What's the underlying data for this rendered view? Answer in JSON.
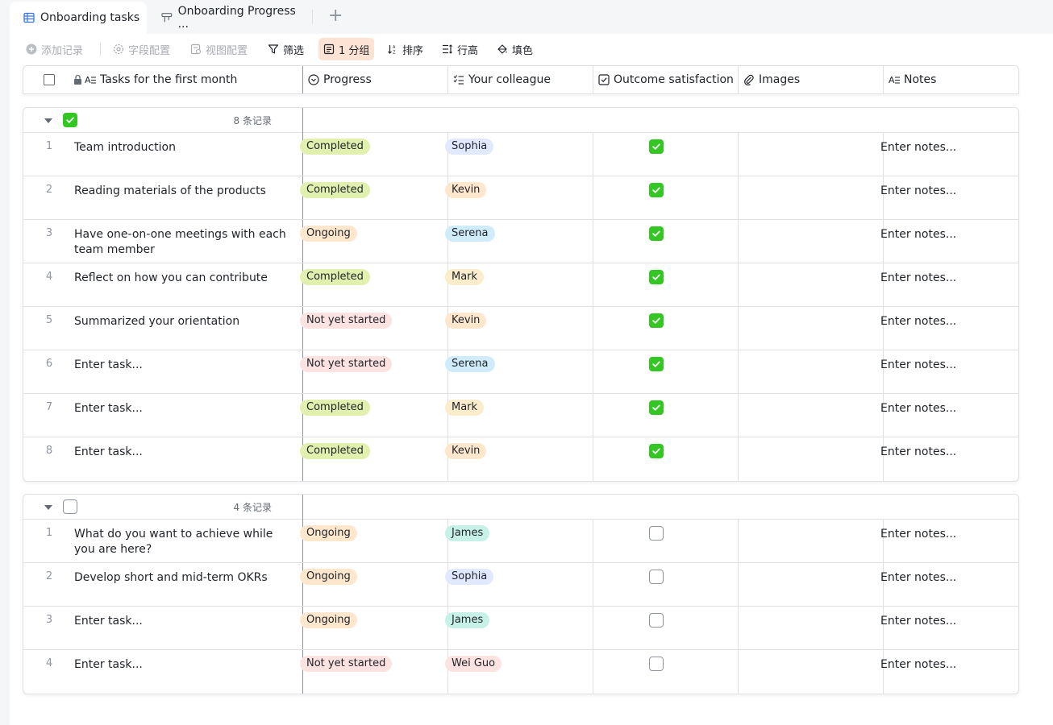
{
  "tabs": [
    {
      "label": "Onboarding tasks",
      "icon": "grid-table-icon",
      "active": true
    },
    {
      "label": "Onboarding Progress ...",
      "icon": "kanban-icon",
      "active": false
    }
  ],
  "toolbar": {
    "add_record": "添加记录",
    "field_config": "字段配置",
    "view_config": "视图配置",
    "filter": "筛选",
    "group": "1 分组",
    "sort": "排序",
    "row_height": "行高",
    "fill": "填色"
  },
  "columns": {
    "task": "Tasks for the first month",
    "progress": "Progress",
    "colleague": "Your colleague",
    "satisfaction": "Outcome satisfaction",
    "images": "Images",
    "notes": "Notes"
  },
  "colors": {
    "completed": "#e1f0ae",
    "ongoing": "#fee7cd",
    "not_started": "#fde2e2",
    "sophia": "#e0e9ff",
    "kevin": "#fee7cd",
    "serena": "#d0ecfb",
    "mark": "#fbeccb",
    "james": "#c7f1e7",
    "wei_guo": "#fde2e2",
    "check_green": "#34c724",
    "accent": "#3370ff"
  },
  "groups": [
    {
      "checked": true,
      "count_label": "8 条记录",
      "rows": [
        {
          "num": "1",
          "task": "Team introduction",
          "progress": "Completed",
          "colleague": "Sophia",
          "satisfied": true,
          "notes": "Enter notes..."
        },
        {
          "num": "2",
          "task": "Reading materials of the products",
          "progress": "Completed",
          "colleague": "Kevin",
          "satisfied": true,
          "notes": "Enter notes..."
        },
        {
          "num": "3",
          "task": "Have one-on-one meetings with each team member",
          "progress": "Ongoing",
          "colleague": "Serena",
          "satisfied": true,
          "notes": "Enter notes..."
        },
        {
          "num": "4",
          "task": "Reflect on how you can contribute",
          "progress": "Completed",
          "colleague": "Mark",
          "satisfied": true,
          "notes": "Enter notes..."
        },
        {
          "num": "5",
          "task": "Summarized your orientation",
          "progress": "Not yet started",
          "colleague": "Kevin",
          "satisfied": true,
          "notes": "Enter notes..."
        },
        {
          "num": "6",
          "task": "Enter task...",
          "progress": "Not yet started",
          "colleague": "Serena",
          "satisfied": true,
          "notes": "Enter notes..."
        },
        {
          "num": "7",
          "task": "Enter task...",
          "progress": "Completed",
          "colleague": "Mark",
          "satisfied": true,
          "notes": "Enter notes..."
        },
        {
          "num": "8",
          "task": "Enter task...",
          "progress": "Completed",
          "colleague": "Kevin",
          "satisfied": true,
          "notes": "Enter notes..."
        }
      ]
    },
    {
      "checked": false,
      "count_label": "4 条记录",
      "rows": [
        {
          "num": "1",
          "task": "What do you want to achieve while you are here?",
          "progress": "Ongoing",
          "colleague": "James",
          "satisfied": false,
          "notes": "Enter notes..."
        },
        {
          "num": "2",
          "task": "Develop short and mid-term OKRs",
          "progress": "Ongoing",
          "colleague": "Sophia",
          "satisfied": false,
          "notes": "Enter notes..."
        },
        {
          "num": "3",
          "task": "Enter task...",
          "progress": "Ongoing",
          "colleague": "James",
          "satisfied": false,
          "notes": "Enter notes..."
        },
        {
          "num": "4",
          "task": "Enter task...",
          "progress": "Not yet started",
          "colleague": "Wei Guo",
          "satisfied": false,
          "notes": "Enter notes..."
        }
      ]
    }
  ]
}
